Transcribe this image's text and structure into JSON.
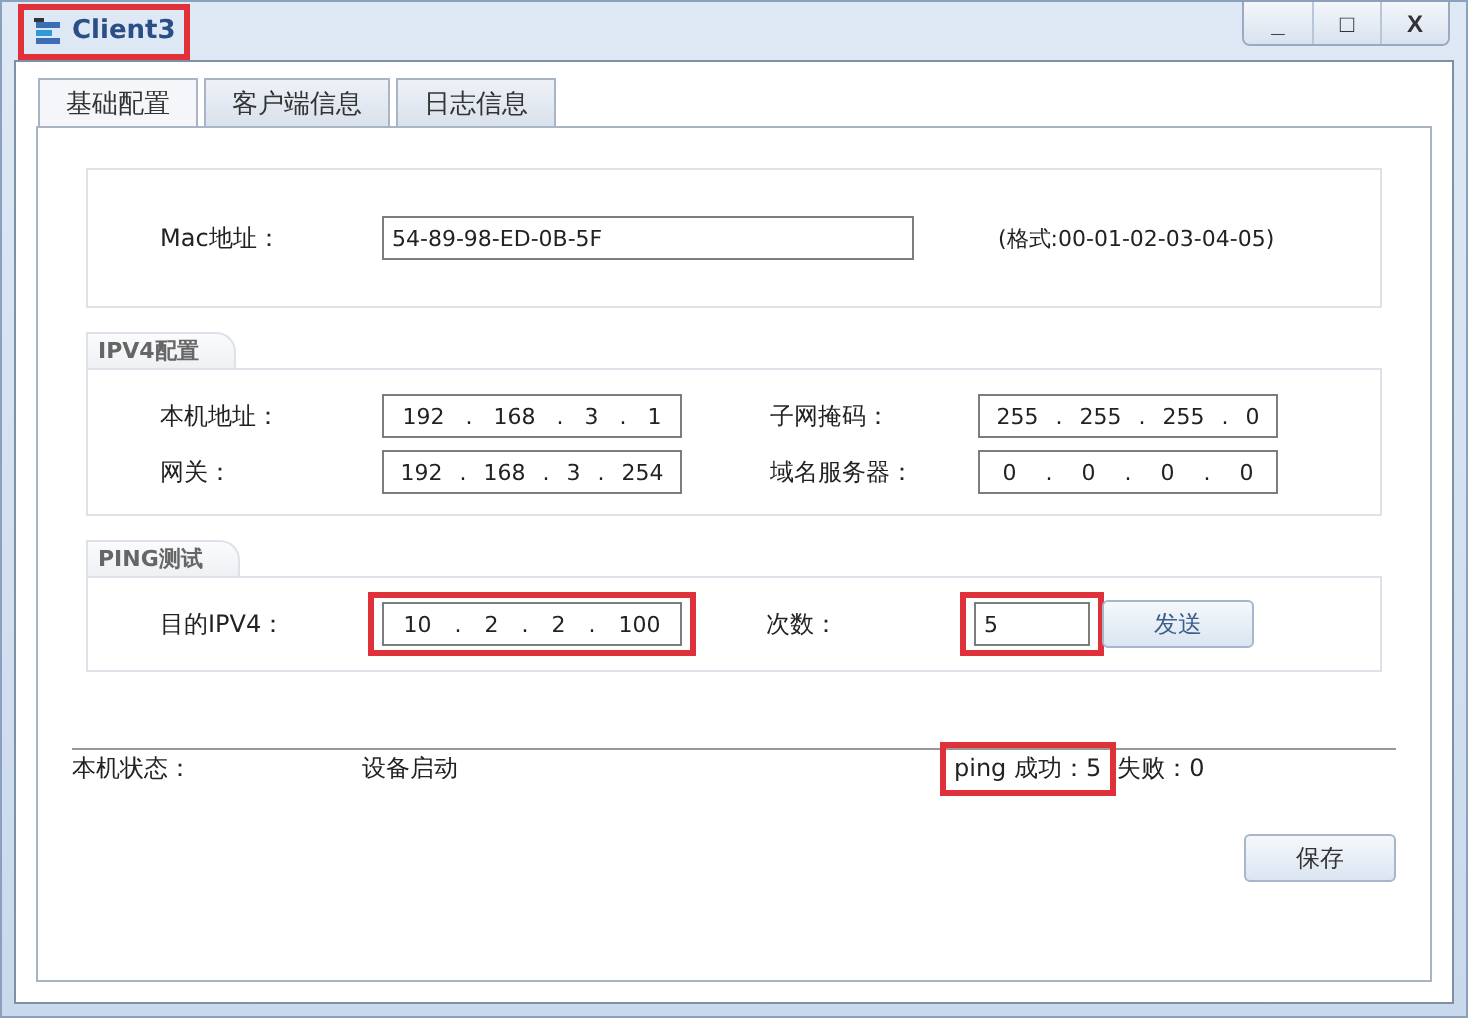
{
  "window": {
    "title": "Client3",
    "title_highlighted": true,
    "controls": [
      "_",
      "□",
      "X"
    ]
  },
  "tabs": [
    {
      "label": "基础配置",
      "selected": true
    },
    {
      "label": "客户端信息",
      "selected": false
    },
    {
      "label": "日志信息",
      "selected": false
    }
  ],
  "ip_separator": ".",
  "mac": {
    "label": "Mac地址：",
    "value": "54-89-98-ED-0B-5F",
    "hint": "(格式:00-01-02-03-04-05)"
  },
  "ipv4": {
    "title": "IPV4配置",
    "fields": [
      {
        "label": "本机地址：",
        "octets": [
          "192",
          "168",
          "3",
          "1"
        ]
      },
      {
        "label": "子网掩码：",
        "octets": [
          "255",
          "255",
          "255",
          "0"
        ]
      },
      {
        "label": "网关：",
        "octets": [
          "192",
          "168",
          "3",
          "254"
        ]
      },
      {
        "label": "域名服务器：",
        "octets": [
          "0",
          "0",
          "0",
          "0"
        ]
      }
    ]
  },
  "ping": {
    "title": "PING测试",
    "target_label": "目的IPV4：",
    "target_octets": [
      "10",
      "2",
      "2",
      "100"
    ],
    "target_highlighted": true,
    "count_label": "次数：",
    "count_value": "5",
    "count_highlighted": true,
    "send_button": "发送"
  },
  "status": {
    "label": "本机状态：",
    "value": "设备启动",
    "success": "ping 成功：5",
    "success_highlighted": true,
    "failure": "失败：0"
  },
  "save_button": "保存"
}
